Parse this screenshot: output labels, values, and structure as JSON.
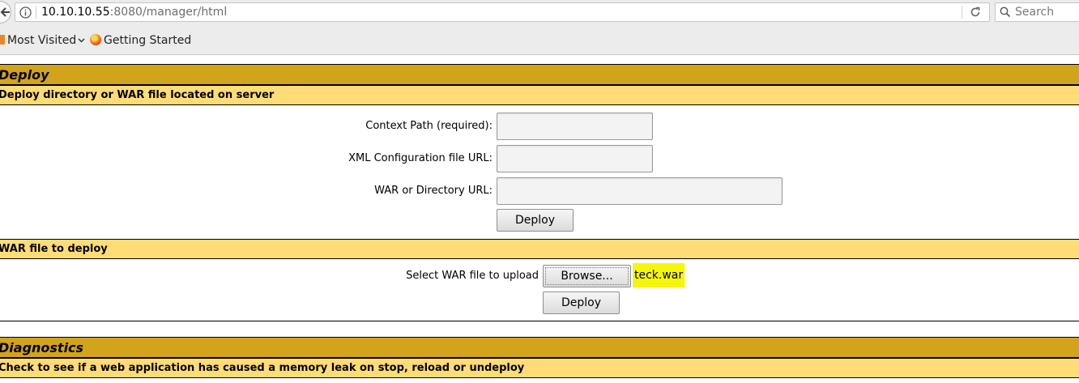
{
  "browser": {
    "url_host": "10.10.10.55",
    "url_path": ":8080/manager/html",
    "search_placeholder": "Search",
    "bookmarks": [
      {
        "label": "Most Visited"
      },
      {
        "label": "Getting Started"
      }
    ]
  },
  "deploy": {
    "title": "Deploy",
    "server_section": {
      "header": "Deploy directory or WAR file located on server",
      "context_path_label": "Context Path (required):",
      "context_path_value": "",
      "xml_config_label": "XML Configuration file URL:",
      "xml_config_value": "",
      "war_dir_label": "WAR or Directory URL:",
      "war_dir_value": "",
      "deploy_button": "Deploy"
    },
    "upload_section": {
      "header": "WAR file to deploy",
      "select_label": "Select WAR file to upload",
      "browse_button": "Browse...",
      "selected_file": "teck.war",
      "deploy_button": "Deploy"
    }
  },
  "diagnostics": {
    "title": "Diagnostics",
    "header": "Check to see if a web application has caused a memory leak on stop, reload or undeploy"
  },
  "colors": {
    "title_bar": "#d2a41c",
    "header_bar": "#ffdc75",
    "file_highlight": "#f6f60c"
  }
}
